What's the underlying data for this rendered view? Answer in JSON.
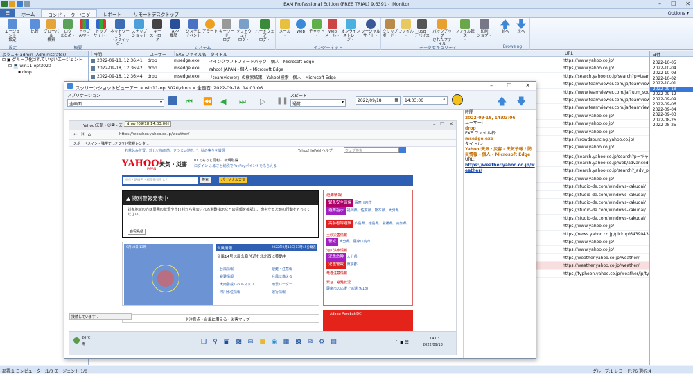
{
  "app": {
    "title": "EAM Professional Edition (FREE TRIAL) 9.6391 - iMonitor",
    "options": "Options ▾",
    "tabs": [
      "ホーム",
      "コンピューター/ログ",
      "レポート",
      "リモートデスクトップ"
    ],
    "active_tab": 1
  },
  "ribbon": {
    "groups": [
      {
        "label": "設定",
        "buttons": [
          "エージェント\n設定"
        ]
      },
      {
        "label": "概要",
        "buttons": [
          "比較",
          "グローバル\n検索",
          "ログ\nまとめ・",
          "トップ\nAPP・",
          "トップ\nサイト・",
          "ネットワーク\nトラフィック・"
        ]
      },
      {
        "label": "システム",
        "buttons": [
          "スナップ\nショット",
          "キー\nストローク",
          "APP\n履歴・",
          "システム\nイベント",
          "アラート",
          "キーワード\nログ",
          "ソフトウェア\nログ・",
          "ハードウェア\nログ・"
        ]
      },
      {
        "label": "インターネット",
        "buttons": [
          "メール\n・",
          "Web",
          "チャット\n・",
          "Web\nメール・",
          "オンライン\nストレージ・",
          "ソーシャル\nサイト・"
        ]
      },
      {
        "label": "データセキュリティ",
        "buttons": [
          "クリップ\nボード・",
          "ファイル\n・",
          "USB\nデバイス",
          "バックアップ\nされたファイル",
          "ファイル転送\n・",
          "印刷\nジョブ・"
        ]
      },
      {
        "label": "Browsing",
        "buttons": [
          "前へ",
          "次へ"
        ]
      }
    ]
  },
  "left_pane": {
    "header": "ようこそ admin (Administrator)",
    "tree": [
      "グループ化されていないエージェント",
      "win11-opt3020",
      "drop"
    ]
  },
  "grid": {
    "columns": [
      "時間",
      "ユーザー",
      "EXE ファイル名",
      "タイトル",
      "URL"
    ],
    "rows": [
      [
        "2022-09-18, 12:36:41",
        "drop",
        "msedge.exe",
        "マインクラフトフィードバック - 個人 - Microsoft Edge",
        "https://www.yahoo.co.jp/"
      ],
      [
        "2022-09-18, 12:36:42",
        "drop",
        "msedge.exe",
        "Yahoo! JAPAN - 個人 - Microsoft Edge",
        "https://www.yahoo.co.jp/"
      ],
      [
        "2022-09-18, 12:36:44",
        "drop",
        "msedge.exe",
        "「teamviewer」の検索結果 - Yahoo!検索 - 個人 - Microsoft Edge",
        "https://search.yahoo.co.jp/search?p=team"
      ],
      [
        "",
        "",
        "",
        "",
        "https://www.teamviewer.com/ja/teamview"
      ],
      [
        "",
        "",
        "",
        "",
        "https://www.teamviewer.com/ja/?utm_sou"
      ],
      [
        "",
        "",
        "",
        "",
        "https://www.teamviewer.com/ja/teamview"
      ],
      [
        "",
        "",
        "",
        "",
        "https://www.teamviewer.com/ja/teamview"
      ],
      [
        "",
        "",
        "",
        "",
        "https://www.yahoo.co.jp/"
      ],
      [
        "",
        "",
        "",
        "",
        "https://www.yahoo.co.jp/"
      ],
      [
        "",
        "",
        "",
        "",
        "https://www.yahoo.co.jp/"
      ],
      [
        "",
        "",
        "",
        "",
        "https://crowdsourcing.yahoo.co.jp/"
      ],
      [
        "",
        "",
        "",
        "",
        "https://www.yahoo.co.jp/"
      ],
      [
        "",
        "",
        "",
        "",
        "https://search.yahoo.co.jp/search?p=キャ"
      ],
      [
        "",
        "",
        "",
        "",
        "https://search.yahoo.co.jp/web/advanced?"
      ],
      [
        "",
        "",
        "",
        "",
        "https://search.yahoo.co.jp/search?_adv_pro"
      ],
      [
        "",
        "",
        "",
        "",
        "https://www.yahoo.co.jp/"
      ],
      [
        "",
        "",
        "",
        "",
        "https://studio-de.com/windows-kakudai/"
      ],
      [
        "",
        "",
        "",
        "",
        "https://studio-de.com/windows-kakudai/"
      ],
      [
        "",
        "",
        "",
        "",
        "https://studio-de.com/windows-kakudai/"
      ],
      [
        "",
        "",
        "",
        "",
        "https://studio-de.com/windows-kakudai/"
      ],
      [
        "",
        "",
        "",
        "",
        "https://studio-de.com/windows-kakudai/"
      ],
      [
        "",
        "",
        "",
        "",
        "https://www.yahoo.co.jp/"
      ],
      [
        "",
        "",
        "",
        "",
        "https://news.yahoo.co.jp/pickup/6439043"
      ],
      [
        "",
        "",
        "",
        "",
        "https://www.yahoo.co.jp/"
      ],
      [
        "",
        "",
        "",
        "",
        "https://www.yahoo.co.jp/"
      ],
      [
        "",
        "",
        "",
        "",
        "https://weather.yahoo.co.jp/weather/"
      ],
      [
        "",
        "",
        "",
        "",
        "https://weather.yahoo.co.jp/weather/"
      ],
      [
        "",
        "",
        "",
        "",
        "https://typhoon.yahoo.co.jp/weather/jp/ty"
      ]
    ],
    "highlight_row": 26
  },
  "right_pane": {
    "header": "日付",
    "dates": [
      "2022-10-05",
      "2022-10-04",
      "2022-10-03",
      "2022-10-02",
      "2022-10-01",
      "2022-09-18",
      "2022-09-12",
      "2022-09-09",
      "2022-09-06",
      "2022-09-04",
      "2022-09-03",
      "2022-08-26",
      "2022-08-25"
    ],
    "selected": 5
  },
  "status": {
    "left": "部署:1  コンピューター:1/0  エージェント:1/0",
    "right": "グループ:1  レコード:76  選択:4"
  },
  "viewer": {
    "title": "スクリーンショットビューアー > win11-opt3020\\drop > 全画面: 2022-09-18, 14:03:06",
    "app_label": "アプリケーション",
    "app_value": "全画面",
    "speed_label": "スピード",
    "speed_value": "通常",
    "date": "2022/09/18",
    "time": "14:03:06",
    "info": {
      "time_label": "時間",
      "time": "2022-09-18, 14:03:06",
      "user_label": "ユーザー:",
      "user": "drop",
      "exe_label": "EXE ファイル名:",
      "exe": "msedge.exe",
      "title_label": "タイトル:",
      "title": "Yahoo!天気・災害 - 天気予報 / 防災情報 - 個人 - Microsoft Edge",
      "url_label": "URL:",
      "url": "https://weather.yahoo.co.jp/weather/"
    },
    "browser": {
      "tab": "Yahoo!天気・災害 - 天...",
      "tab_tooltip": "drop [09/18 14:03:06]",
      "address": "https://weather.yahoo.co.jp/weather/",
      "bookmarks": [
        "スポードメイン - 独学で...",
        "クラウド監視レンタ..."
      ],
      "site_top_left": "お盆休み位置、珍しい梅雨前、さつまい地など、秋の実りを厳選",
      "site_top_right": "Yahoo! JAPAN  ヘルプ",
      "site_search_ph": "ウェブ検索",
      "logo_main": "YAHOO!",
      "logo_sub": "JAPAN",
      "logo_section": "天気・災害",
      "promo1": "ID でもっと便利に 新規取得",
      "promo2": "ログイン  ふるさと納税でPayPayポイントをもらえる",
      "region_ph": "地点・路線名・郵便番号を入力",
      "search_btn": "検索",
      "personal_btn": "パーソナル天気",
      "warning_title": "特別警報発表中",
      "warning_body": "対象地域の方は周囲の状況や市町村から発表される避難指示などの情報を確認し、命を守るための行動をとってください。",
      "warning_link": "鹿児島県",
      "typhoon_title": "台風情報",
      "typhoon_date": "2022年9月18日 13時45分発表",
      "typhoon_text": "台風14号は屋久島付近を北北西に移動中",
      "menu": [
        "台風情報",
        "避難情報",
        "大雨警戒レベルマップ",
        "河川水位情報",
        "避難・注意報",
        "台風に備える",
        "雨雲レーダー",
        "運行情報"
      ],
      "panel_title": "避難情報",
      "panel_items": [
        [
          "緊急安全確保",
          "薩摩川内市"
        ],
        [
          "避難指示",
          "福岡県、佐賀県、熊本県、大分県"
        ],
        [
          "高齢者等避難",
          "広島県、徳島県、愛媛県、高知県"
        ]
      ],
      "panel_items2": [
        [
          "警戒",
          "大分県、薩摩川内市"
        ],
        [
          "氾濫危険",
          "大分県"
        ],
        [
          "氾濫警戒",
          "東京都"
        ]
      ],
      "panel_sub1": "土砂災害情報",
      "panel_sub2": "河川洪水情報",
      "panel_sub3": "竜巻注意情報",
      "panel_sub4": "緊急・避難状況",
      "panel_footer": "薩摩市の応援で派遣(9/18)",
      "ad": "Adobe Acrobat DC",
      "bottom_link": "や注意点 - 台風に備える・災害マップ",
      "loading": "接続しています...",
      "weather_temp": "26°C",
      "weather_desc": "雨",
      "clock_time": "14:03",
      "clock_date": "2022/09/18",
      "map_date": "9月18日 13時"
    }
  }
}
